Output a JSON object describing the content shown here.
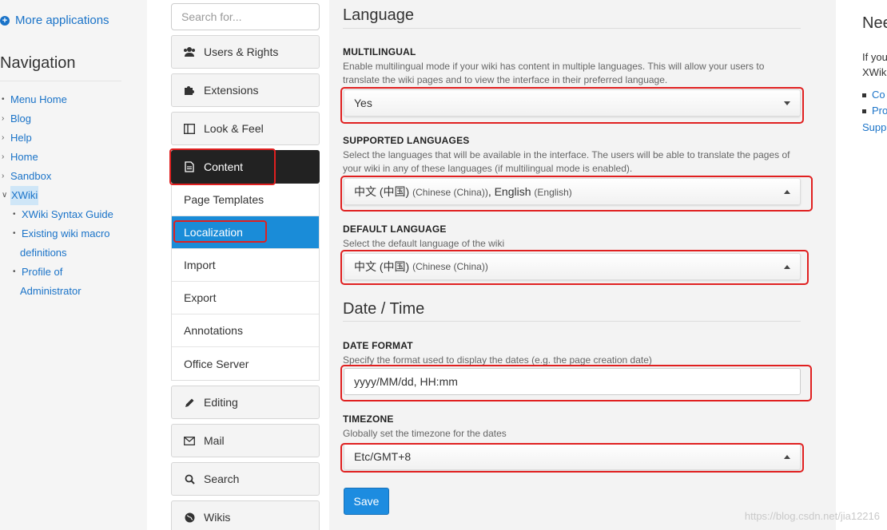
{
  "left_nav": {
    "more_apps": "More applications",
    "title": "Navigation",
    "items": [
      {
        "mark": "•",
        "label": "Menu Home"
      },
      {
        "mark": "›",
        "label": "Blog"
      },
      {
        "mark": "›",
        "label": "Help"
      },
      {
        "mark": "›",
        "label": "Home"
      },
      {
        "mark": "›",
        "label": "Sandbox"
      },
      {
        "mark": "∨",
        "label": "XWiki"
      },
      {
        "mark": "•",
        "label": "XWiki Syntax Guide"
      },
      {
        "mark": "•",
        "label": "Existing wiki macro"
      },
      {
        "mark": "",
        "label": "definitions"
      },
      {
        "mark": "•",
        "label": "Profile of"
      },
      {
        "mark": "",
        "label": "Administrator"
      }
    ]
  },
  "admin_menu": {
    "search_placeholder": "Search for...",
    "categories_top": [
      {
        "label": "Users & Rights",
        "icon": "users-icon"
      },
      {
        "label": "Extensions",
        "icon": "puzzle-icon"
      },
      {
        "label": "Look & Feel",
        "icon": "layout-icon"
      }
    ],
    "content": {
      "label": "Content",
      "icon": "document-icon"
    },
    "content_items": [
      "Page Templates",
      "Localization",
      "Import",
      "Export",
      "Annotations",
      "Office Server"
    ],
    "active_item": "Localization",
    "categories_bottom": [
      {
        "label": "Editing",
        "icon": "pencil-icon"
      },
      {
        "label": "Mail",
        "icon": "envelope-icon"
      },
      {
        "label": "Search",
        "icon": "search-icon"
      },
      {
        "label": "Wikis",
        "icon": "globe-icon"
      }
    ]
  },
  "main": {
    "language_heading": "Language",
    "multilingual": {
      "label": "MULTILINGUAL",
      "hint": "Enable multilingual mode if your wiki has content in multiple languages. This will allow your users to translate the wiki pages and to view the interface in their preferred language.",
      "value": "Yes"
    },
    "supported": {
      "label": "SUPPORTED LANGUAGES",
      "hint": "Select the languages that will be available in the interface. The users will be able to translate the pages of your wiki in any of these languages (if multilingual mode is enabled).",
      "lang1": "中文 (中国)",
      "lang1_note": "(Chinese (China))",
      "sep": ",",
      "lang2": "English",
      "lang2_note": "(English)"
    },
    "default": {
      "label": "DEFAULT LANGUAGE",
      "hint": "Select the default language of the wiki",
      "value": "中文 (中国)",
      "value_note": "(Chinese (China))"
    },
    "datetime_heading": "Date / Time",
    "date_format": {
      "label": "DATE FORMAT",
      "hint": "Specify the format used to display the dates (e.g. the page creation date)",
      "value": "yyyy/MM/dd, HH:mm"
    },
    "timezone": {
      "label": "TIMEZONE",
      "hint": "Globally set the timezone for the dates",
      "value": "Etc/GMT+8"
    },
    "save_label": "Save"
  },
  "right_panel": {
    "title": "Nee",
    "line1": "If you",
    "line2": "XWik",
    "link1": "Co",
    "link2": "Pro",
    "link3": "Supp"
  },
  "watermark": "https://blog.csdn.net/jia12216",
  "colors": {
    "accent": "#1a8cd8",
    "highlight": "#e02020",
    "active_dark": "#222222"
  }
}
